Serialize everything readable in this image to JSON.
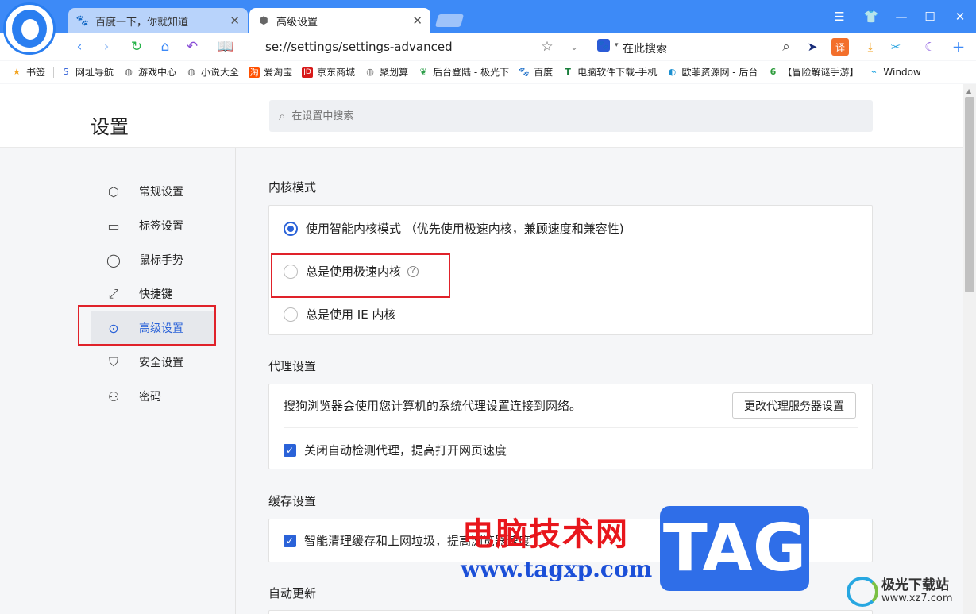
{
  "tabs": [
    {
      "title": "百度一下，你就知道",
      "icon": "baidu-paw-icon"
    },
    {
      "title": "高级设置",
      "icon": "settings-gear-icon"
    }
  ],
  "address_bar": {
    "url": "se://settings/settings-advanced"
  },
  "search_bar": {
    "text": "在此搜索"
  },
  "bookmarks": [
    {
      "label": "书签",
      "icon": "star-icon"
    },
    {
      "label": "网址导航",
      "icon": "sogou-icon"
    },
    {
      "label": "游戏中心",
      "icon": "globe-icon"
    },
    {
      "label": "小说大全",
      "icon": "globe-icon"
    },
    {
      "label": "爱淘宝",
      "icon": "taobao-icon"
    },
    {
      "label": "京东商城",
      "icon": "jd-icon"
    },
    {
      "label": "聚划算",
      "icon": "globe-icon"
    },
    {
      "label": "后台登陆 - 极光下",
      "icon": "leaf-icon"
    },
    {
      "label": "百度",
      "icon": "baidu-paw-icon"
    },
    {
      "label": "电脑软件下载-手机",
      "icon": "t-icon"
    },
    {
      "label": "欧菲资源网 - 后台",
      "icon": "ofei-icon"
    },
    {
      "label": "【冒险解谜手游】",
      "icon": "six-icon"
    },
    {
      "label": "Window",
      "icon": "windows-icon"
    }
  ],
  "header": {
    "title": "设置",
    "search_placeholder": "在设置中搜索"
  },
  "sidebar": {
    "items": [
      {
        "label": "常规设置",
        "icon": "hexagon-settings-icon"
      },
      {
        "label": "标签设置",
        "icon": "tab-icon"
      },
      {
        "label": "鼠标手势",
        "icon": "mouse-icon"
      },
      {
        "label": "快捷键",
        "icon": "shortcut-arrow-icon"
      },
      {
        "label": "高级设置",
        "icon": "ellipsis-circle-icon"
      },
      {
        "label": "安全设置",
        "icon": "shield-check-icon"
      },
      {
        "label": "密码",
        "icon": "user-icon"
      }
    ],
    "active": "高级设置"
  },
  "kernel": {
    "title": "内核模式",
    "options": [
      {
        "label": "使用智能内核模式 （优先使用极速内核，兼顾速度和兼容性)",
        "selected": true
      },
      {
        "label": "总是使用极速内核",
        "selected": false
      },
      {
        "label": "总是使用 IE 内核",
        "selected": false
      }
    ]
  },
  "proxy": {
    "title": "代理设置",
    "description": "搜狗浏览器会使用您计算机的系统代理设置连接到网络。",
    "button": "更改代理服务器设置",
    "checkbox": "关闭自动检测代理，提高打开网页速度"
  },
  "cache": {
    "title": "缓存设置",
    "checkbox": "智能清理缓存和上网垃圾，提高浏览器速度"
  },
  "autoupdate": {
    "title": "自动更新"
  },
  "watermark": {
    "cn": "电脑技术网",
    "url": "www.tagxp.com",
    "tag": "TAG",
    "site_name": "极光下载站",
    "site_url": "www.xz7.com"
  },
  "colors": {
    "titlebar": "#3d8af7",
    "accent": "#2a62d8",
    "highlight": "#e0222a"
  }
}
